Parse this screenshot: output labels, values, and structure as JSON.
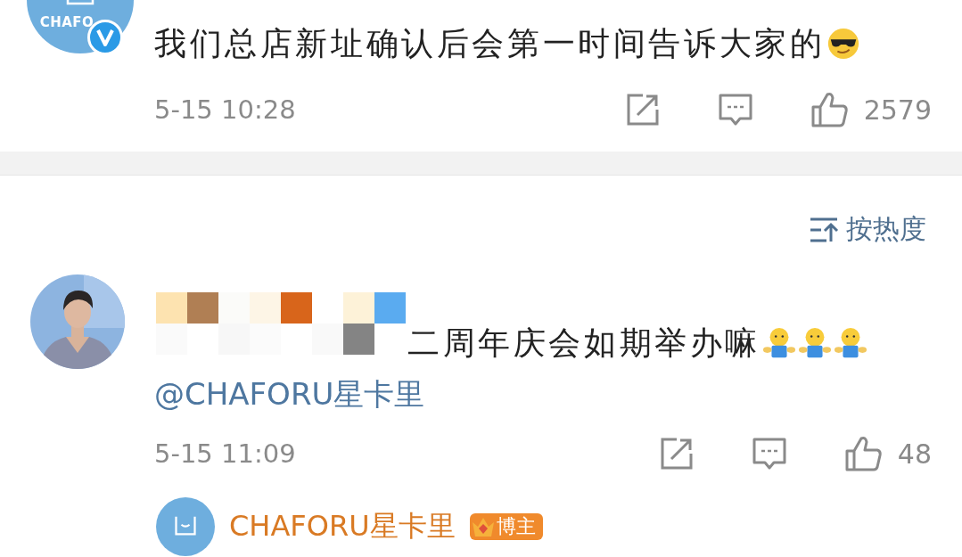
{
  "comments": [
    {
      "kind": "official",
      "avatar": {
        "kind": "logo",
        "text": "CHAFO",
        "verified": true
      },
      "text": "我们总店新址确认后会第一时间告诉大家的",
      "emojis": [
        {
          "kind": "sunglasses"
        }
      ],
      "time": "5-15 10:28",
      "likes": "2579"
    },
    {
      "kind": "masked",
      "text": "二周年庆会如期举办嘛",
      "emojis": [
        {
          "kind": "hug"
        },
        {
          "kind": "hug"
        },
        {
          "kind": "hug"
        }
      ],
      "mention": "@CHAFORU星卡里",
      "time": "5-15 11:09",
      "likes": "48"
    }
  ],
  "sort": {
    "label": "按热度"
  },
  "reply_preview": {
    "name": "CHAFORU星卡里",
    "badge": "博主"
  }
}
